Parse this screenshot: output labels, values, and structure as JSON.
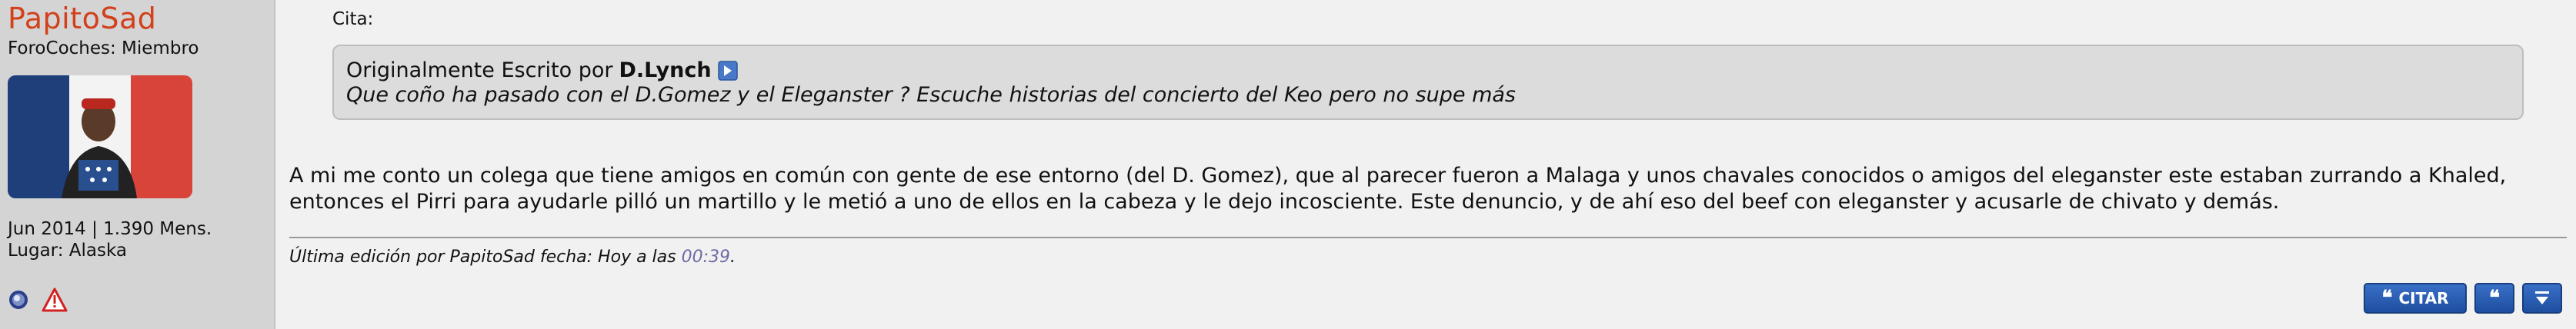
{
  "user": {
    "name": "PapitoSad",
    "title": "ForoCoches: Miembro",
    "join_info": "Jun 2014 | 1.390 Mens.",
    "location": "Lugar: Alaska"
  },
  "post": {
    "cita_label": "Cita:",
    "quote": {
      "prefix": "Originalmente Escrito por",
      "author": "D.Lynch",
      "text": "Que coño ha pasado con el D.Gomez y el Eleganster ? Escuche historias del concierto del Keo pero no supe más"
    },
    "body_line1": "A mi me conto un colega que tiene amigos en común con gente de ese entorno (del D. Gomez), que al parecer fueron a Malaga y unos chavales conocidos o amigos del eleganster este estaban zurrando a Khaled,",
    "body_line2": "entonces el Pirri para ayudarle pilló un martillo y le metió a uno de ellos en la cabeza y le dejo incosciente. Este denuncio, y de ahí eso del beef con eleganster y acusarle de chivato y demás.",
    "edit_prefix": "Última edición por PapitoSad fecha: Hoy a las ",
    "edit_time": "00:39",
    "edit_suffix": "."
  },
  "actions": {
    "citar_label": "CITAR",
    "multiquote_glyph": "❝",
    "citar_glyph": "❝"
  },
  "icons": {
    "status": "online-status-icon",
    "report": "report-warning-icon",
    "view_post": "view-post-arrow-icon",
    "quick_reply": "quick-reply-arrow-icon"
  },
  "colors": {
    "username": "#d2401c",
    "button": "#1d4f9f",
    "edit_time": "#6e6aa6"
  }
}
